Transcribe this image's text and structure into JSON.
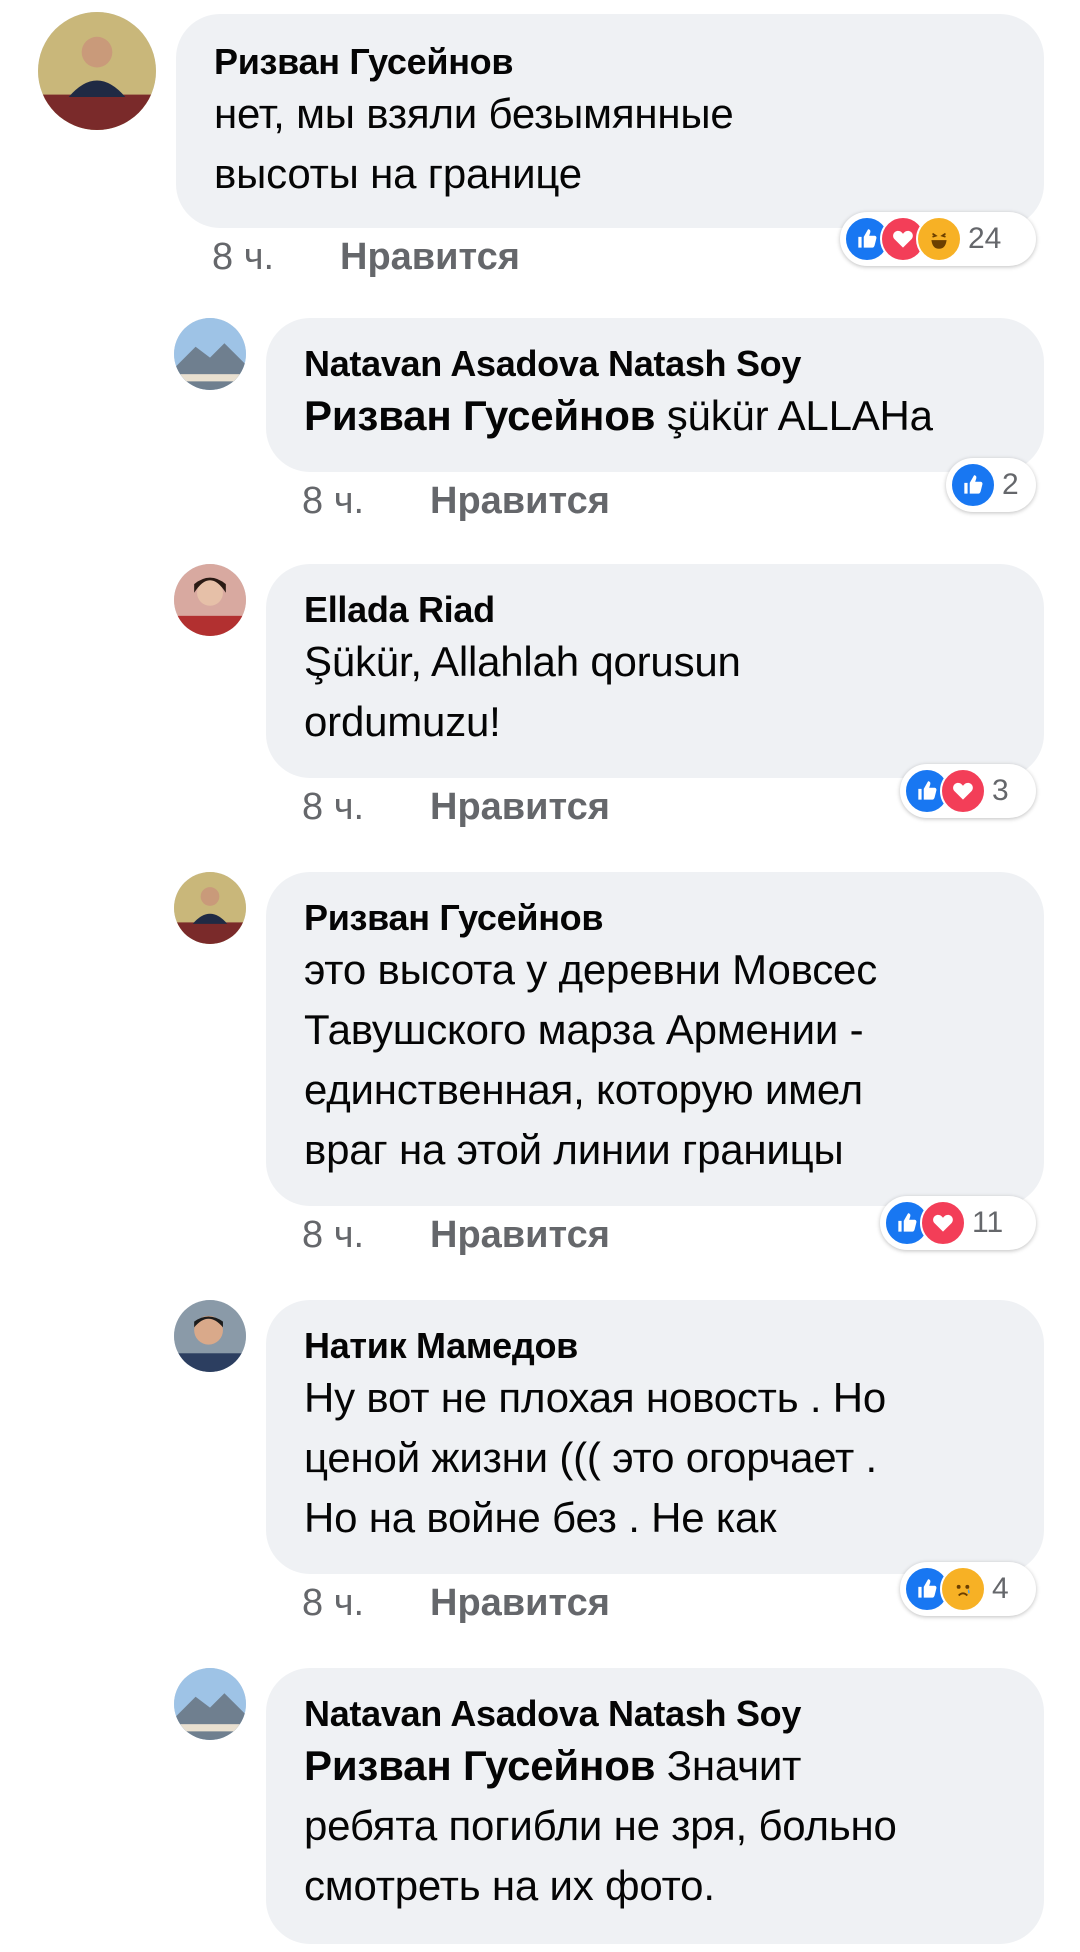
{
  "comments": [
    {
      "author": "Ризван Гусейнов",
      "mention": "",
      "lines": [
        "нет, мы взяли безымянные",
        "высоты на границе"
      ],
      "time": "8 ч.",
      "like_label": "Нравится",
      "reactions": [
        "like-icon",
        "love-icon",
        "haha-icon"
      ],
      "reaction_count": "24",
      "avatar": "man-in-suit-photo"
    },
    {
      "author": "Natavan Asadova Natash Soy",
      "mention": "Ризван Гусейнов",
      "lines": [
        " şükür ALLAHa"
      ],
      "time": "8 ч.",
      "like_label": "Нравится",
      "reactions": [
        "like-icon"
      ],
      "reaction_count": "2",
      "avatar": "mountain-landscape-photo"
    },
    {
      "author": "Ellada Riad",
      "mention": "",
      "lines": [
        "Şükür, Allahlah qorusun",
        "ordumuzu!"
      ],
      "time": "8 ч.",
      "like_label": "Нравится",
      "reactions": [
        "like-icon",
        "love-icon"
      ],
      "reaction_count": "3",
      "avatar": "woman-portrait-photo"
    },
    {
      "author": "Ризван Гусейнов",
      "mention": "",
      "lines": [
        "это высота у деревни Мовсес",
        "Тавушского марза Армении -",
        "единственная, которую имел",
        "враг на этой линии границы"
      ],
      "time": "8 ч.",
      "like_label": "Нравится",
      "reactions": [
        "like-icon",
        "love-icon"
      ],
      "reaction_count": "11",
      "avatar": "man-in-suit-photo"
    },
    {
      "author": "Натик Мамедов",
      "mention": "",
      "lines": [
        "Ну вот не плохая новость . Но",
        "ценой жизни ((( это огорчает .",
        "Но на войне без . Не как"
      ],
      "time": "8 ч.",
      "like_label": "Нравится",
      "reactions": [
        "like-icon",
        "sad-icon"
      ],
      "reaction_count": "4",
      "avatar": "man-portrait-photo"
    },
    {
      "author": "Natavan Asadova Natash Soy",
      "mention": "Ризван Гусейнов",
      "lines": [
        " Значит",
        "ребята погибли не зря, больно",
        "смотреть на их фото."
      ],
      "time": "",
      "like_label": "",
      "reactions": [],
      "reaction_count": "",
      "avatar": "mountain-landscape-photo"
    }
  ],
  "colors": {
    "bubble": "#eff1f4",
    "meta_text": "#65676b",
    "like_blue": "#1877f2",
    "love_red": "#f33e58",
    "emoji_yellow": "#f7b125"
  }
}
